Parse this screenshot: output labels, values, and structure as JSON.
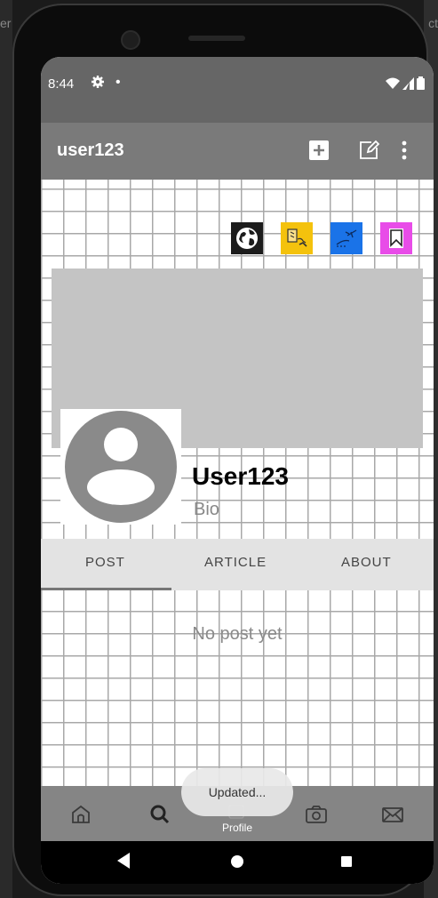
{
  "edge": {
    "left_text": "er",
    "right_text": "ct"
  },
  "status": {
    "time": "8:44",
    "gear_icon": "settings-gear-icon",
    "dot": "•"
  },
  "appbar": {
    "title": "user123",
    "add_icon": "add-box-icon",
    "edit_icon": "edit-icon",
    "more_icon": "more-vert-icon"
  },
  "badges": [
    {
      "name": "globe",
      "bg": "#1c1c1c"
    },
    {
      "name": "map-travel",
      "bg": "#f4c20d"
    },
    {
      "name": "flight-travel",
      "bg": "#1a73e8"
    },
    {
      "name": "bookmark",
      "bg": "#e84ce8"
    }
  ],
  "profile": {
    "name": "User123",
    "bio": "Bio"
  },
  "tabs": [
    {
      "label": "POST",
      "selected": true
    },
    {
      "label": "ARTICLE",
      "selected": false
    },
    {
      "label": "ABOUT",
      "selected": false
    }
  ],
  "empty_state": "No post yet",
  "toast": "Updated...",
  "bottom_nav": {
    "items": [
      "home",
      "search",
      "profile",
      "camera",
      "mail"
    ],
    "selected_label": "Profile"
  }
}
